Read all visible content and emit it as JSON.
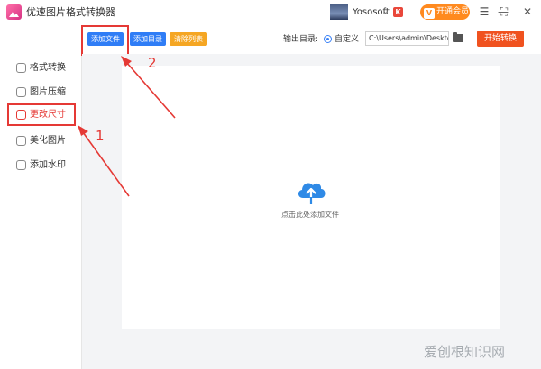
{
  "app": {
    "title": "优速图片格式转换器"
  },
  "header": {
    "user_name": "Yososoft",
    "user_chevron": "⌄",
    "vip_label": "开通会员",
    "vip_icon_glyph": "V",
    "badge_glyph": "K",
    "window_buttons": {
      "menu": "☰",
      "minimize": "—",
      "maximize": "⛶",
      "close": "✕"
    }
  },
  "sidebar": {
    "items": [
      {
        "label": "格式转换",
        "icon": "format-convert-icon",
        "active": false
      },
      {
        "label": "图片压缩",
        "icon": "compress-icon",
        "active": false
      },
      {
        "label": "更改尺寸",
        "icon": "resize-icon",
        "active": true
      },
      {
        "label": "美化图片",
        "icon": "beautify-icon",
        "active": false
      },
      {
        "label": "添加水印",
        "icon": "watermark-icon",
        "active": false
      }
    ]
  },
  "toolbar": {
    "add_file": "添加文件",
    "add_folder": "添加目录",
    "clear_list": "清除列表",
    "output_label": "输出目录:",
    "custom_label": "自定义",
    "output_path": "C:\\Users\\admin\\Deskto",
    "start_button": "开始转换"
  },
  "main": {
    "drop_hint": "点击此处添加文件"
  },
  "annotations": {
    "label_1": "1",
    "label_2": "2",
    "color": "#e53935"
  },
  "watermark": "爱创根知识网",
  "colors": {
    "add_file_bg": "#2f7df6",
    "add_folder_bg": "#2f7df6",
    "clear_list_bg": "#f5a623",
    "start_bg": "#f0521f",
    "vip_bg": "#ff8a1f",
    "cloud": "#2f8ae6"
  }
}
